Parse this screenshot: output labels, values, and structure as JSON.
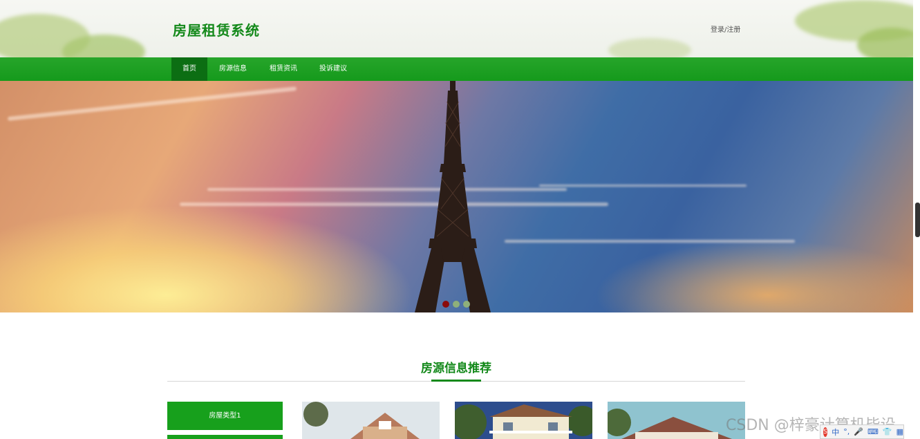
{
  "header": {
    "site_title": "房屋租赁系统",
    "login_link": "登录/注册"
  },
  "nav": {
    "items": [
      {
        "label": "首页",
        "active": true
      },
      {
        "label": "房源信息",
        "active": false
      },
      {
        "label": "租赁资讯",
        "active": false
      },
      {
        "label": "投诉建议",
        "active": false
      }
    ]
  },
  "banner": {
    "slide_count": 3,
    "active_slide": 1,
    "dot_colors": [
      "#8b0a0a",
      "#8fb07a",
      "#8fb07a"
    ]
  },
  "section": {
    "title": "房源信息推荐"
  },
  "house_types": [
    "房屋类型1"
  ],
  "colors": {
    "brand_green": "#13891a",
    "nav_green": "#1a9f1f",
    "nav_active": "#0c6e13"
  },
  "watermark": "CSDN @梓豪计算机毕设",
  "ime": {
    "label": "中"
  }
}
